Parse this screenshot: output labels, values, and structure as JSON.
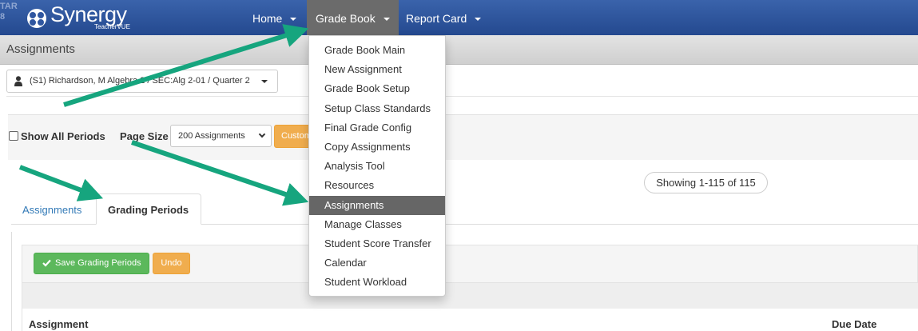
{
  "topbar": {
    "corner_text": "TAR 8",
    "logo_text": "Synergy",
    "logo_sub": "TeacherVUE",
    "nav": [
      {
        "label": "Home"
      },
      {
        "label": "Grade Book"
      },
      {
        "label": "Report Card"
      }
    ]
  },
  "page": {
    "title": "Assignments"
  },
  "class_selector": {
    "value": "(S1) Richardson, M Algebra 2 / SEC:Alg 2-01 / Quarter 2"
  },
  "filters": {
    "show_all_periods": "Show All Periods",
    "page_size_label": "Page Size",
    "page_size_value": "200 Assignments",
    "custom_button": "Custom"
  },
  "showing": "Showing 1-115 of 115",
  "tabs": [
    {
      "label": "Assignments"
    },
    {
      "label": "Grading Periods"
    }
  ],
  "toolbar": {
    "save_label": "Save Grading Periods",
    "undo_label": "Undo"
  },
  "grid": {
    "col_assignment": "Assignment",
    "col_due": "Due Date"
  },
  "dropdown": {
    "items": [
      {
        "label": "Grade Book Main"
      },
      {
        "label": "New Assignment"
      },
      {
        "label": "Grade Book Setup"
      },
      {
        "label": "Setup Class Standards"
      },
      {
        "label": "Final Grade Config"
      },
      {
        "label": "Copy Assignments"
      },
      {
        "label": "Analysis Tool"
      },
      {
        "label": "Resources"
      },
      {
        "label": "Assignments"
      },
      {
        "label": "Manage Classes"
      },
      {
        "label": "Student Score Transfer"
      },
      {
        "label": "Calendar"
      },
      {
        "label": "Student Workload"
      }
    ],
    "selected_item": "Assignments"
  },
  "colors": {
    "nav_blue": "#2f56a0",
    "arrow_green": "#16a57e",
    "success_green": "#5cb85c",
    "warning_orange": "#f0ad4e",
    "selected_gray": "#666666"
  }
}
